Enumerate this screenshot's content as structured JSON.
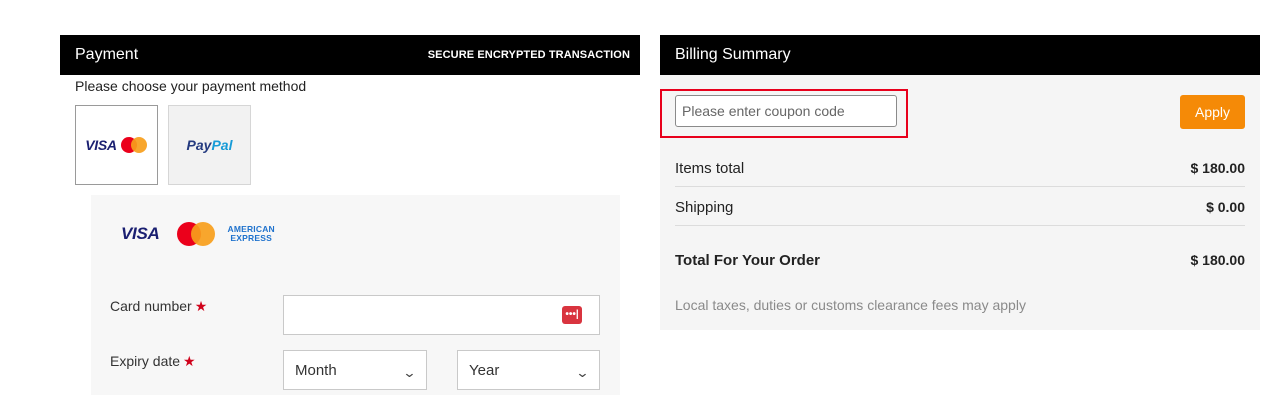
{
  "payment": {
    "title": "Payment",
    "secure_label": "SECURE ENCRYPTED TRANSACTION",
    "choose_method_text": "Please choose your payment method",
    "methods": [
      {
        "id": "card",
        "label": "VISA",
        "selected": true
      },
      {
        "id": "paypal",
        "label_a": "Pay",
        "label_b": "Pal",
        "selected": false
      }
    ],
    "card_brands": {
      "visa": "VISA",
      "amex_line1": "AMERICAN",
      "amex_line2": "EXPRESS"
    },
    "card_number": {
      "label": "Card number",
      "required_mark": "★",
      "value": "",
      "icon_text": "•••|"
    },
    "expiry": {
      "label": "Expiry date",
      "required_mark": "★",
      "month_selected": "Month",
      "year_selected": "Year"
    }
  },
  "billing": {
    "title": "Billing Summary",
    "coupon": {
      "placeholder": "Please enter coupon code",
      "value": ""
    },
    "apply_label": "Apply",
    "items_total": {
      "label": "Items total",
      "amount": "$ 180.00"
    },
    "shipping": {
      "label": "Shipping",
      "amount": "$ 0.00"
    },
    "total": {
      "label": "Total For Your Order",
      "amount": "$ 180.00"
    },
    "disclaimer": "Local taxes, duties or customs clearance fees may apply"
  },
  "colors": {
    "header_bg": "#000000",
    "accent_orange": "#f58a07",
    "highlight_red": "#e8001c",
    "required_red": "#d0021b",
    "visa_blue": "#1a1f71",
    "mastercard_red": "#eb001b",
    "mastercard_orange": "#f79e1b",
    "amex_blue": "#1f72cd"
  }
}
